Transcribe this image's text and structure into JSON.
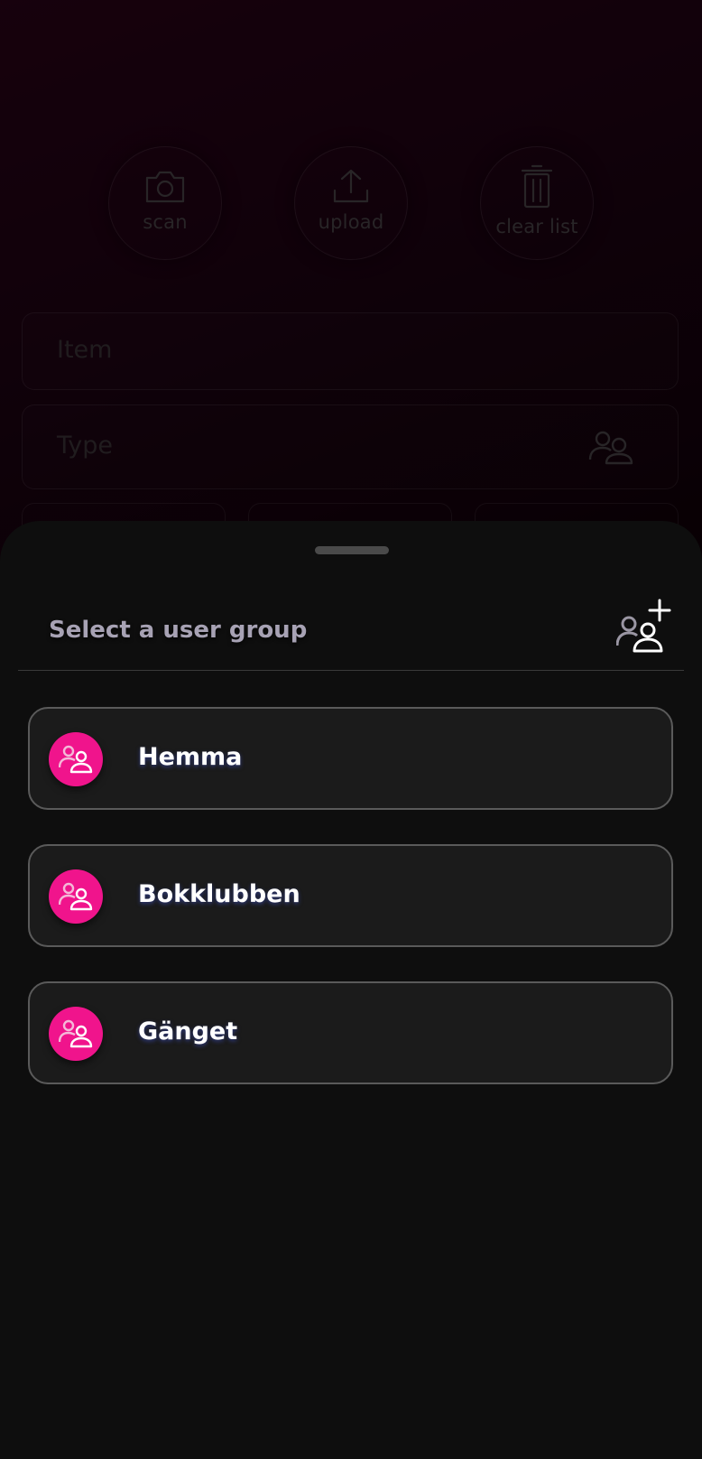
{
  "actions": {
    "scan": "scan",
    "upload": "upload",
    "clear": "clear list"
  },
  "form": {
    "item_placeholder": "Item",
    "type_placeholder": "Type"
  },
  "sheet": {
    "title": "Select a user group",
    "add_icon": "group-add-icon"
  },
  "groups": [
    {
      "name": "Hemma",
      "icon": "group-icon"
    },
    {
      "name": "Bokklubben",
      "icon": "group-icon"
    },
    {
      "name": "Gänget",
      "icon": "group-icon"
    }
  ],
  "colors": {
    "accent": "#f0148c",
    "sheet_bg": "#0e0e0e",
    "card_bg": "#1b1b1b",
    "card_border": "#5a5a5a",
    "title_text": "#a7a2b4"
  }
}
